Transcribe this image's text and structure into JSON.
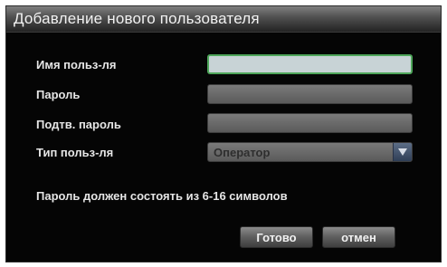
{
  "dialog": {
    "title": "Добавление нового пользователя"
  },
  "form": {
    "username_label": "Имя польз-ля",
    "username_value": "",
    "password_label": "Пароль",
    "password_value": "",
    "confirm_label": "Подтв. пароль",
    "confirm_value": "",
    "type_label": "Тип польз-ля",
    "type_selected": "Оператор"
  },
  "hint": "Пароль должен состоять из 6-16 символов",
  "buttons": {
    "ok_label": "Готово",
    "cancel_label": "отмен"
  },
  "icons": {
    "dropdown": "chevron-down-icon"
  },
  "colors": {
    "background": "#050505",
    "active_field_border": "#4ea65a",
    "dropdown_button": "#3e4d66"
  }
}
